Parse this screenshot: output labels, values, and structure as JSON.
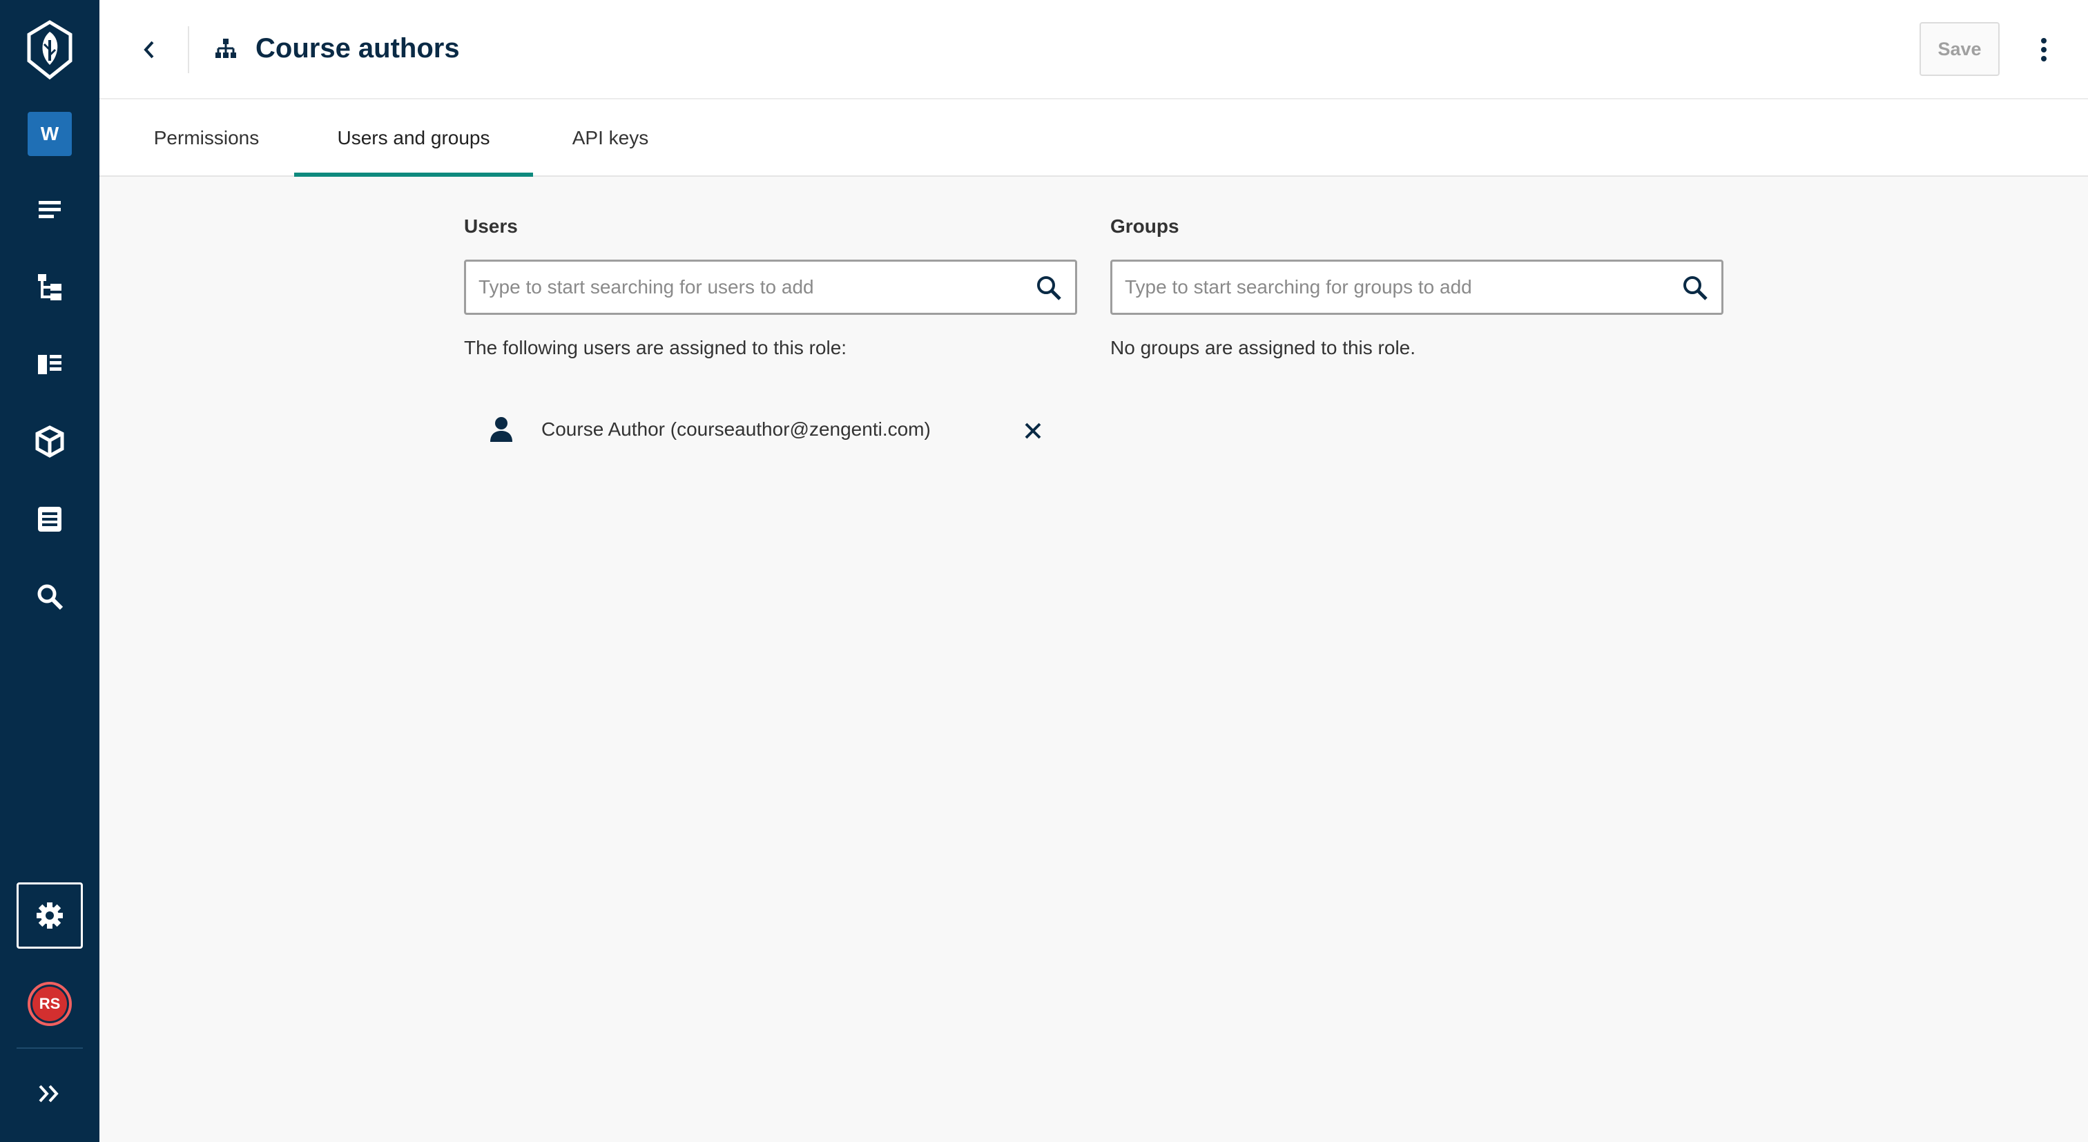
{
  "app": {
    "workspace_initial": "W",
    "user_initials": "RS",
    "sidebar_icons": [
      "logo-icon",
      "workspace-badge",
      "content-icon",
      "site-tree-icon",
      "blocks-icon",
      "assets-icon",
      "entries-icon",
      "search-icon",
      "settings-icon",
      "avatar",
      "expand-icon"
    ],
    "colors": {
      "sidebar_bg": "#062c4a",
      "accent": "#0f8a7e",
      "workspace_badge": "#1f6fb5",
      "avatar": "#d32f2f",
      "title": "#0a2a45"
    }
  },
  "header": {
    "title": "Course authors",
    "save_label": "Save"
  },
  "tabs": [
    {
      "label": "Permissions",
      "active": false
    },
    {
      "label": "Users and groups",
      "active": true
    },
    {
      "label": "API keys",
      "active": false
    }
  ],
  "users": {
    "label": "Users",
    "search_placeholder": "Type to start searching for users to add",
    "assigned_text": "The following users are assigned to this role:",
    "list": [
      {
        "name": "Course Author (courseauthor@zengenti.com)"
      }
    ]
  },
  "groups": {
    "label": "Groups",
    "search_placeholder": "Type to start searching for groups to add",
    "assigned_text": "No groups are assigned to this role."
  }
}
